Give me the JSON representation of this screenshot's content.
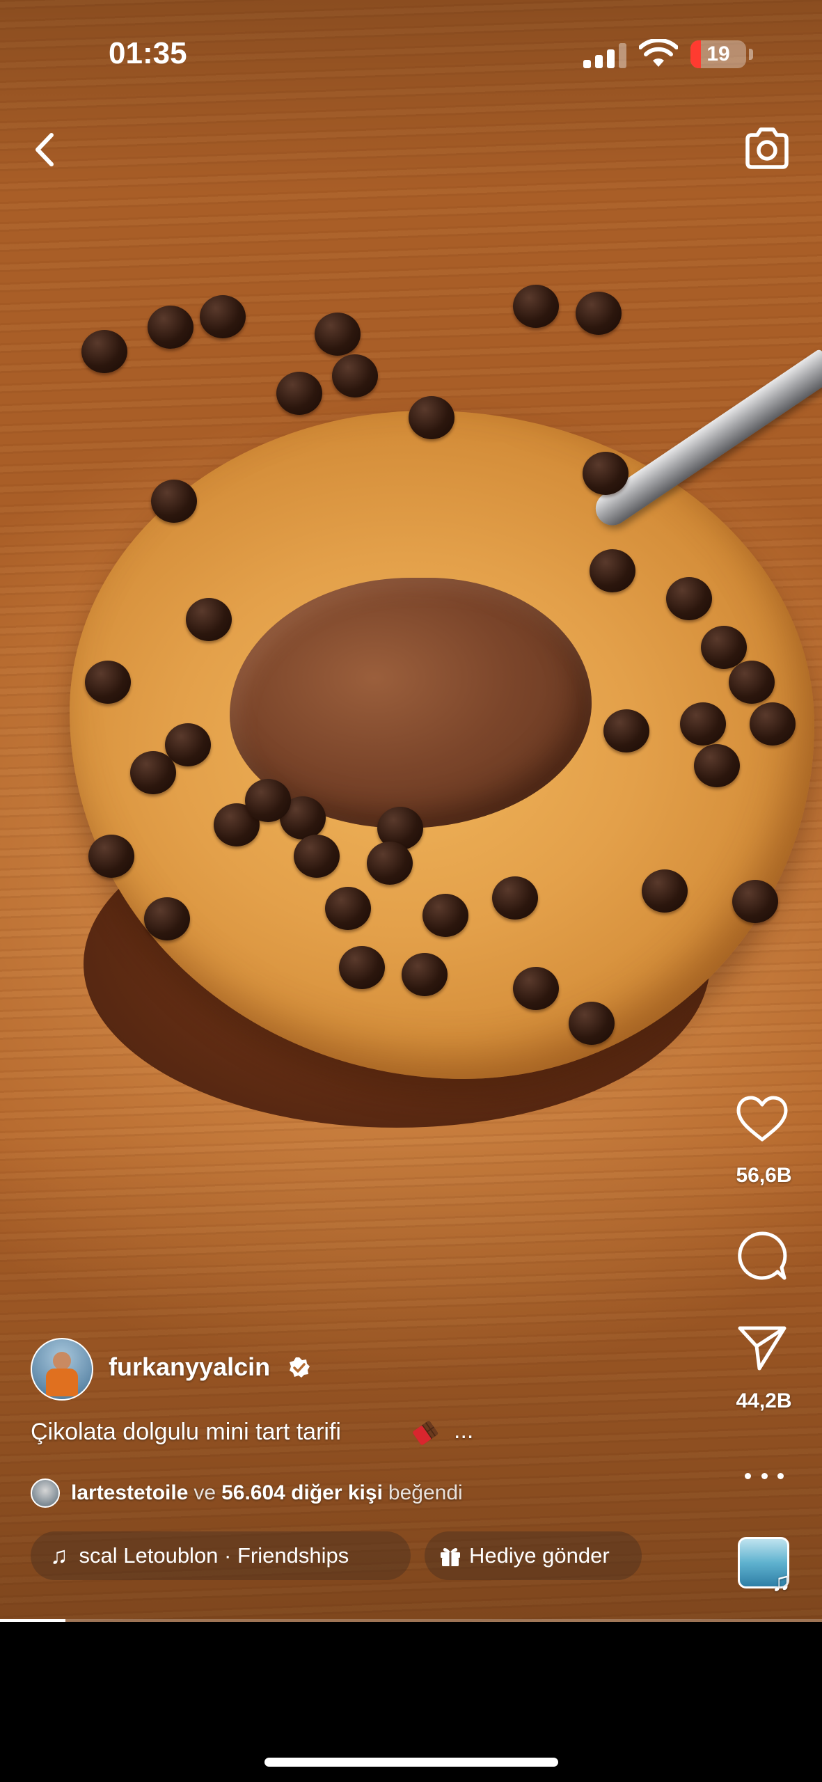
{
  "status_bar": {
    "time": "01:35",
    "battery_level": "19",
    "battery_fraction": 0.19
  },
  "nav": {
    "back_icon": "chevron-left-icon",
    "camera_icon": "camera-icon"
  },
  "actions": {
    "like_count": "56,6B",
    "comment_icon": "comment-icon",
    "share_count": "44,2B",
    "more_icon": "more-horizontal-icon"
  },
  "post": {
    "username": "furkanyyalcin",
    "verified": true,
    "caption": "Çikolata dolgulu mini tart tarifi",
    "caption_emoji": "chocolate-bar-emoji",
    "caption_more": "...",
    "likes": {
      "first_liker": "lartestetoile",
      "connector": "ve",
      "others": "56.604 diğer kişi",
      "suffix": "beğendi"
    }
  },
  "audio": {
    "track": "scal Letoublon · Friendships",
    "note_icon": "music-note-icon"
  },
  "gift": {
    "label": "Hediye gönder",
    "icon": "gift-icon"
  },
  "playback": {
    "progress_fraction": 0.08
  },
  "colors": {
    "battery_low": "#ff3b30",
    "verified_badge": "#ffffff"
  }
}
